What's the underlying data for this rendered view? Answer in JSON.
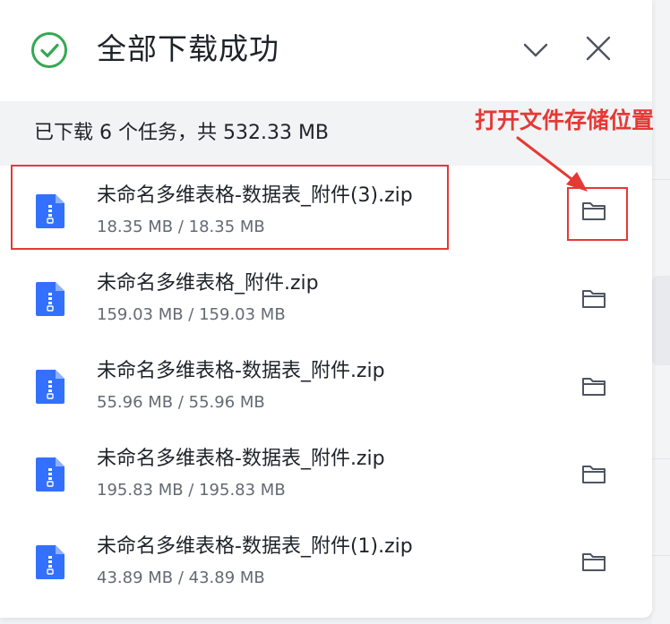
{
  "header": {
    "title": "全部下载成功"
  },
  "summary": {
    "text": "已下载 6 个任务，共 532.33 MB"
  },
  "files": [
    {
      "name": "未命名多维表格-数据表_附件(3).zip",
      "size": "18.35 MB / 18.35 MB"
    },
    {
      "name": "未命名多维表格_附件.zip",
      "size": "159.03 MB / 159.03 MB"
    },
    {
      "name": "未命名多维表格-数据表_附件.zip",
      "size": "55.96 MB / 55.96 MB"
    },
    {
      "name": "未命名多维表格-数据表_附件.zip",
      "size": "195.83 MB / 195.83 MB"
    },
    {
      "name": "未命名多维表格-数据表_附件(1).zip",
      "size": "43.89 MB / 43.89 MB"
    }
  ],
  "annotation": {
    "text": "打开文件存储位置"
  },
  "icons": {
    "status": "check-circle-icon",
    "collapse": "chevron-down-icon",
    "close": "close-icon",
    "file": "zip-file-icon",
    "folder": "folder-icon"
  },
  "colors": {
    "success": "#34a853",
    "file_icon": "#3370ff",
    "annotation": "#e53935",
    "summary_bg": "#f2f3f5"
  }
}
